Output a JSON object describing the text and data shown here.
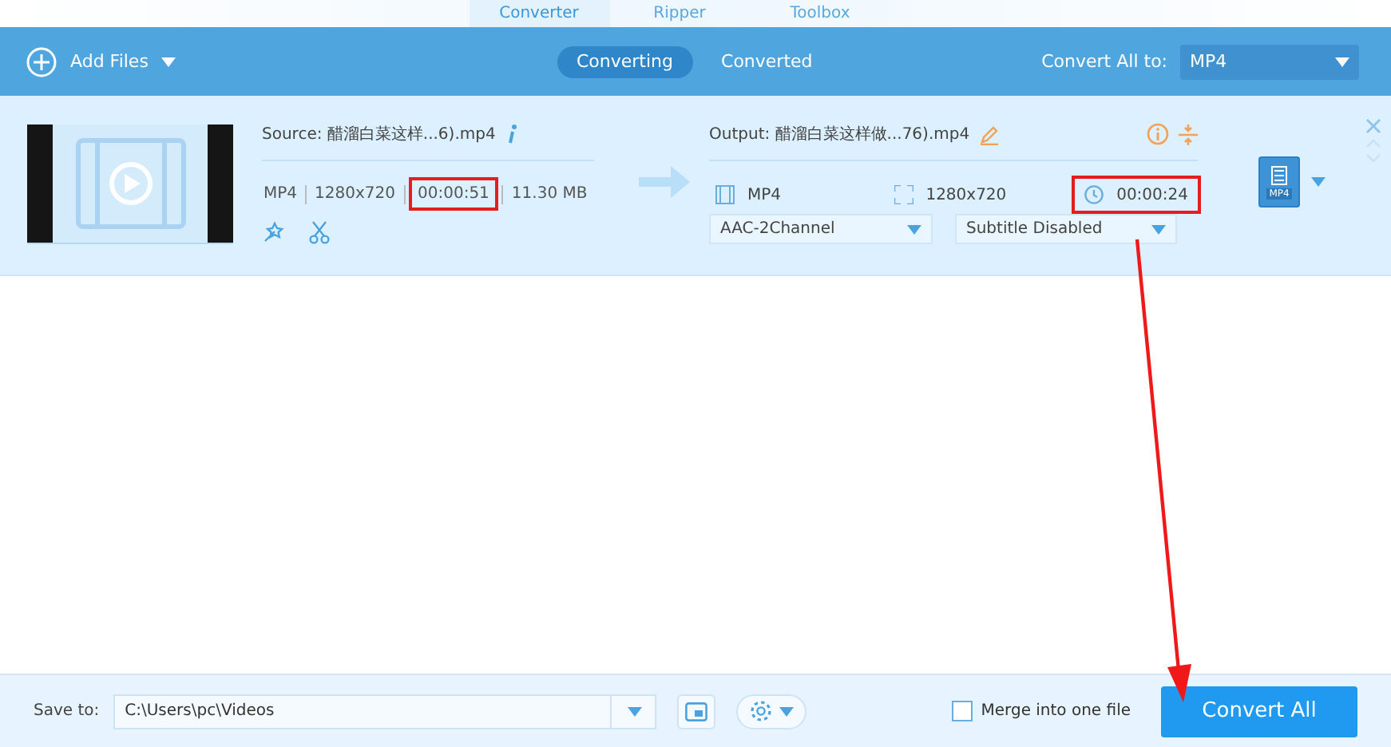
{
  "top_tabs": [
    {
      "label": "Converter",
      "selected": true
    },
    {
      "label": "Ripper",
      "selected": false
    },
    {
      "label": "Toolbox",
      "selected": false
    }
  ],
  "toolbar": {
    "add_files": "Add Files",
    "views": [
      {
        "label": "Converting",
        "selected": true
      },
      {
        "label": "Converted",
        "selected": false
      }
    ],
    "convert_all_label": "Convert All to:",
    "convert_all_format": "MP4"
  },
  "file": {
    "source_name": "Source: 醋溜白菜这样...6).mp4",
    "source_meta": [
      {
        "text": "MP4",
        "highlighted": false
      },
      {
        "text": "1280x720",
        "highlighted": false
      },
      {
        "text": "00:00:51",
        "highlighted": true
      },
      {
        "text": "11.30 MB",
        "highlighted": false
      }
    ],
    "output_name": "Output: 醋溜白菜这样做...76).mp4",
    "output_meta": [
      {
        "kind": "format",
        "text": "MP4",
        "highlighted": false
      },
      {
        "kind": "resolution",
        "text": "1280x720",
        "highlighted": false
      },
      {
        "kind": "duration",
        "text": "00:00:24",
        "highlighted": true
      }
    ],
    "audio": "AAC-2Channel",
    "subtitle": "Subtitle Disabled",
    "format_badge": "MP4"
  },
  "bottom": {
    "save_to_label": "Save to:",
    "save_path": "C:\\Users\\pc\\Videos",
    "merge": {
      "label": "Merge into one file",
      "checked": false
    },
    "convert_button": "Convert All"
  },
  "annotation_arrow": true
}
